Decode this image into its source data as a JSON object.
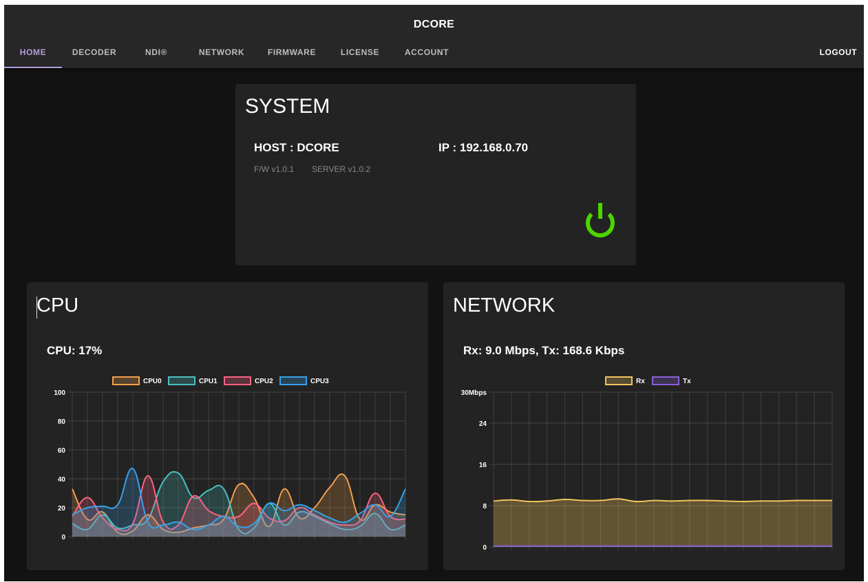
{
  "app": {
    "title": "DCORE"
  },
  "nav": {
    "tabs": [
      {
        "label": "HOME",
        "active": true
      },
      {
        "label": "DECODER",
        "active": false
      },
      {
        "label": "NDI®",
        "active": false
      },
      {
        "label": "NETWORK",
        "active": false
      },
      {
        "label": "FIRMWARE",
        "active": false
      },
      {
        "label": "LICENSE",
        "active": false
      },
      {
        "label": "ACCOUNT",
        "active": false
      }
    ],
    "logout_label": "LOGOUT"
  },
  "system": {
    "title": "SYSTEM",
    "host_text": "HOST : DCORE",
    "ip_text": "IP : 192.168.0.70",
    "firmware_text": "F/W v1.0.1",
    "server_text": "SERVER v1.0.2",
    "power_icon": "power-icon",
    "power_color": "#4cd600"
  },
  "cpu": {
    "title": "CPU",
    "usage_text": "CPU: 17%"
  },
  "network": {
    "title": "NETWORK",
    "rate_text": "Rx: 9.0 Mbps, Tx: 168.6 Kbps"
  },
  "colors": {
    "accent": "#b39ddb",
    "background": "#121212",
    "card": "#232323",
    "appbar": "#272727"
  },
  "chart_data": [
    {
      "type": "area",
      "y_tick_labels": [
        "0",
        "20",
        "40",
        "60",
        "80",
        "100"
      ],
      "ylim": [
        0,
        100
      ],
      "grid": true,
      "legend_position": "top",
      "series": [
        {
          "name": "CPU0",
          "color": "#f2a04b",
          "values": [
            33,
            12,
            17,
            3,
            4,
            15,
            5,
            3,
            6,
            8,
            12,
            36,
            27,
            7,
            33,
            13,
            20,
            34,
            42,
            12,
            22,
            17,
            15
          ]
        },
        {
          "name": "CPU1",
          "color": "#4bc0c0",
          "values": [
            9,
            5,
            15,
            6,
            8,
            12,
            38,
            44,
            27,
            32,
            33,
            5,
            6,
            23,
            8,
            17,
            14,
            9,
            5,
            7,
            16,
            5,
            8
          ]
        },
        {
          "name": "CPU2",
          "color": "#ff6384",
          "values": [
            14,
            27,
            13,
            5,
            9,
            42,
            10,
            8,
            28,
            18,
            14,
            14,
            23,
            13,
            11,
            20,
            15,
            10,
            8,
            11,
            30,
            14,
            12
          ]
        },
        {
          "name": "CPU3",
          "color": "#36a2eb",
          "values": [
            15,
            20,
            21,
            22,
            47,
            10,
            8,
            10,
            5,
            8,
            14,
            7,
            9,
            23,
            18,
            22,
            18,
            13,
            10,
            16,
            22,
            14,
            33
          ]
        }
      ]
    },
    {
      "type": "area",
      "y_tick_labels": [
        "0",
        "8",
        "16",
        "24",
        "30Mbps"
      ],
      "ylim": [
        0,
        30
      ],
      "grid": true,
      "legend_position": "top",
      "series": [
        {
          "name": "Rx",
          "color": "#f2c55c",
          "values": [
            8.9,
            9.1,
            8.8,
            8.9,
            9.2,
            9.0,
            9.0,
            9.3,
            8.8,
            9.0,
            8.9,
            9.0,
            9.0,
            8.9,
            8.8,
            8.9,
            8.9,
            9.0,
            9.0,
            9.0
          ]
        },
        {
          "name": "Tx",
          "color": "#8a60d6",
          "values": [
            0.17,
            0.17,
            0.17,
            0.17,
            0.17,
            0.17,
            0.17,
            0.17,
            0.17,
            0.17,
            0.17,
            0.17,
            0.17,
            0.17,
            0.17,
            0.17,
            0.17,
            0.17,
            0.17,
            0.17
          ]
        }
      ]
    }
  ]
}
